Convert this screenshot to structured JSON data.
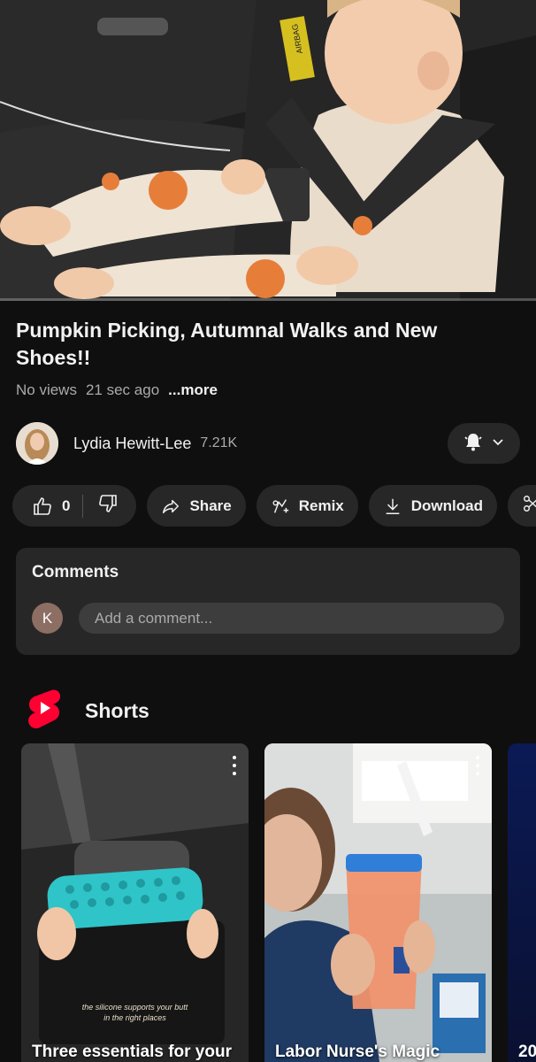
{
  "video": {
    "title": "Pumpkin Picking, Autumnal Walks and New Shoes!!",
    "views": "No views",
    "age": "21 sec ago",
    "more_label": "...more",
    "progress_fraction": 0.0,
    "airbag_label": "AIRBAG"
  },
  "channel": {
    "name": "Lydia Hewitt-Lee",
    "subscribers": "7.21K",
    "bell_icon": "bell-icon"
  },
  "actions": {
    "like_count": "0",
    "share_label": "Share",
    "remix_label": "Remix",
    "download_label": "Download"
  },
  "comments": {
    "title": "Comments",
    "user_initial": "K",
    "placeholder": "Add a comment..."
  },
  "shorts": {
    "title": "Shorts",
    "cards": [
      {
        "title": "Three essentials for your",
        "caption_line1": "the silicone supports your butt",
        "caption_line2": "in the right places"
      },
      {
        "title": "Labor Nurse's Magic"
      },
      {
        "title": "20"
      }
    ]
  },
  "colors": {
    "background": "#0f0f0f",
    "surface": "#272727",
    "text_primary": "#f1f1f1",
    "text_secondary": "#aaaaaa",
    "shorts_red": "#ff0033"
  }
}
